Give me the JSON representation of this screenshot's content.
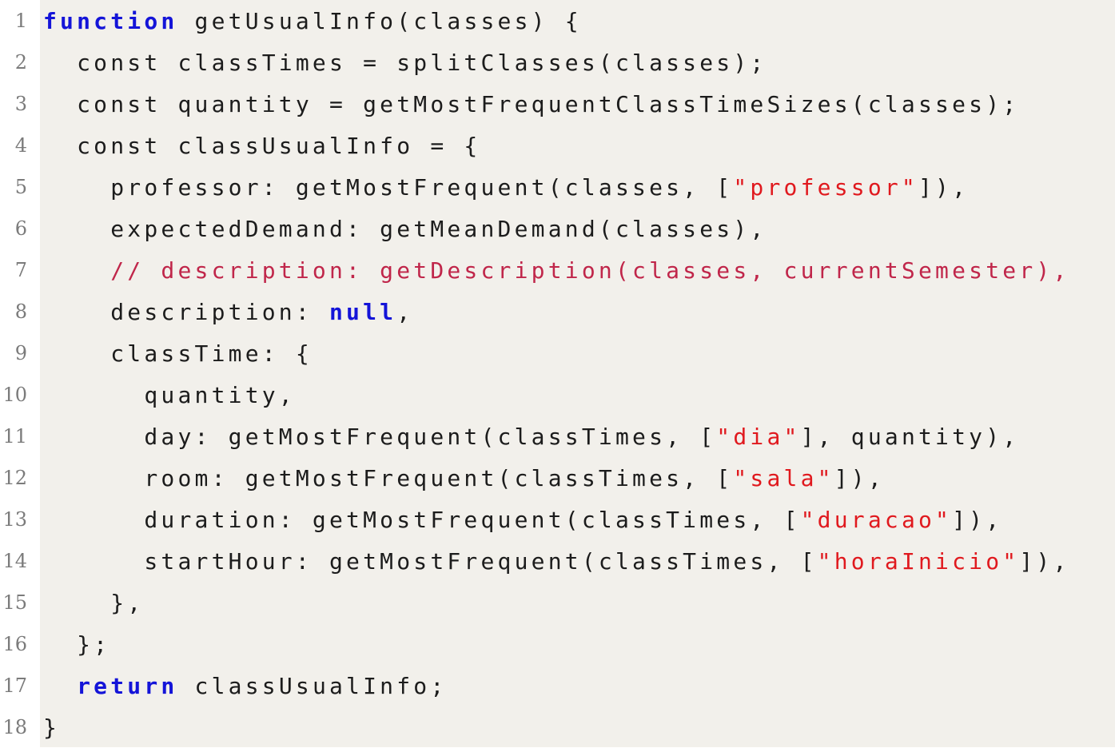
{
  "code": {
    "lines": [
      {
        "n": "1",
        "tokens": [
          {
            "t": "function",
            "k": "kw"
          },
          {
            "t": " getUsualInfo(classes) {",
            "k": "plain"
          }
        ]
      },
      {
        "n": "2",
        "tokens": [
          {
            "t": "  const classTimes = splitClasses(classes);",
            "k": "plain"
          }
        ]
      },
      {
        "n": "3",
        "tokens": [
          {
            "t": "  const quantity = getMostFrequentClassTimeSizes(classes);",
            "k": "plain"
          }
        ]
      },
      {
        "n": "4",
        "tokens": [
          {
            "t": "  const classUsualInfo = {",
            "k": "plain"
          }
        ]
      },
      {
        "n": "5",
        "tokens": [
          {
            "t": "    professor: getMostFrequent(classes, [",
            "k": "plain"
          },
          {
            "t": "\"professor\"",
            "k": "str"
          },
          {
            "t": "]),",
            "k": "plain"
          }
        ]
      },
      {
        "n": "6",
        "tokens": [
          {
            "t": "    expectedDemand: getMeanDemand(classes),",
            "k": "plain"
          }
        ]
      },
      {
        "n": "7",
        "tokens": [
          {
            "t": "    // description: getDescription(classes, currentSemester),",
            "k": "cmt"
          }
        ]
      },
      {
        "n": "8",
        "tokens": [
          {
            "t": "    description: ",
            "k": "plain"
          },
          {
            "t": "null",
            "k": "kw"
          },
          {
            "t": ",",
            "k": "plain"
          }
        ]
      },
      {
        "n": "9",
        "tokens": [
          {
            "t": "    classTime: {",
            "k": "plain"
          }
        ]
      },
      {
        "n": "10",
        "tokens": [
          {
            "t": "      quantity,",
            "k": "plain"
          }
        ]
      },
      {
        "n": "11",
        "tokens": [
          {
            "t": "      day: getMostFrequent(classTimes, [",
            "k": "plain"
          },
          {
            "t": "\"dia\"",
            "k": "str"
          },
          {
            "t": "], quantity),",
            "k": "plain"
          }
        ]
      },
      {
        "n": "12",
        "tokens": [
          {
            "t": "      room: getMostFrequent(classTimes, [",
            "k": "plain"
          },
          {
            "t": "\"sala\"",
            "k": "str"
          },
          {
            "t": "]),",
            "k": "plain"
          }
        ]
      },
      {
        "n": "13",
        "tokens": [
          {
            "t": "      duration: getMostFrequent(classTimes, [",
            "k": "plain"
          },
          {
            "t": "\"duracao\"",
            "k": "str"
          },
          {
            "t": "]),",
            "k": "plain"
          }
        ]
      },
      {
        "n": "14",
        "tokens": [
          {
            "t": "      startHour: getMostFrequent(classTimes, [",
            "k": "plain"
          },
          {
            "t": "\"horaInicio\"",
            "k": "str"
          },
          {
            "t": "]),",
            "k": "plain"
          }
        ]
      },
      {
        "n": "15",
        "tokens": [
          {
            "t": "    },",
            "k": "plain"
          }
        ]
      },
      {
        "n": "16",
        "tokens": [
          {
            "t": "  };",
            "k": "plain"
          }
        ]
      },
      {
        "n": "17",
        "tokens": [
          {
            "t": "  ",
            "k": "plain"
          },
          {
            "t": "return",
            "k": "kw"
          },
          {
            "t": " classUsualInfo;",
            "k": "plain"
          }
        ]
      },
      {
        "n": "18",
        "tokens": [
          {
            "t": "}",
            "k": "plain"
          }
        ]
      }
    ]
  },
  "colors": {
    "keyword": "#1414d8",
    "string": "#e0191e",
    "comment": "#c0264a",
    "background": "#f2f0eb",
    "line_number": "#7b7b7b"
  }
}
